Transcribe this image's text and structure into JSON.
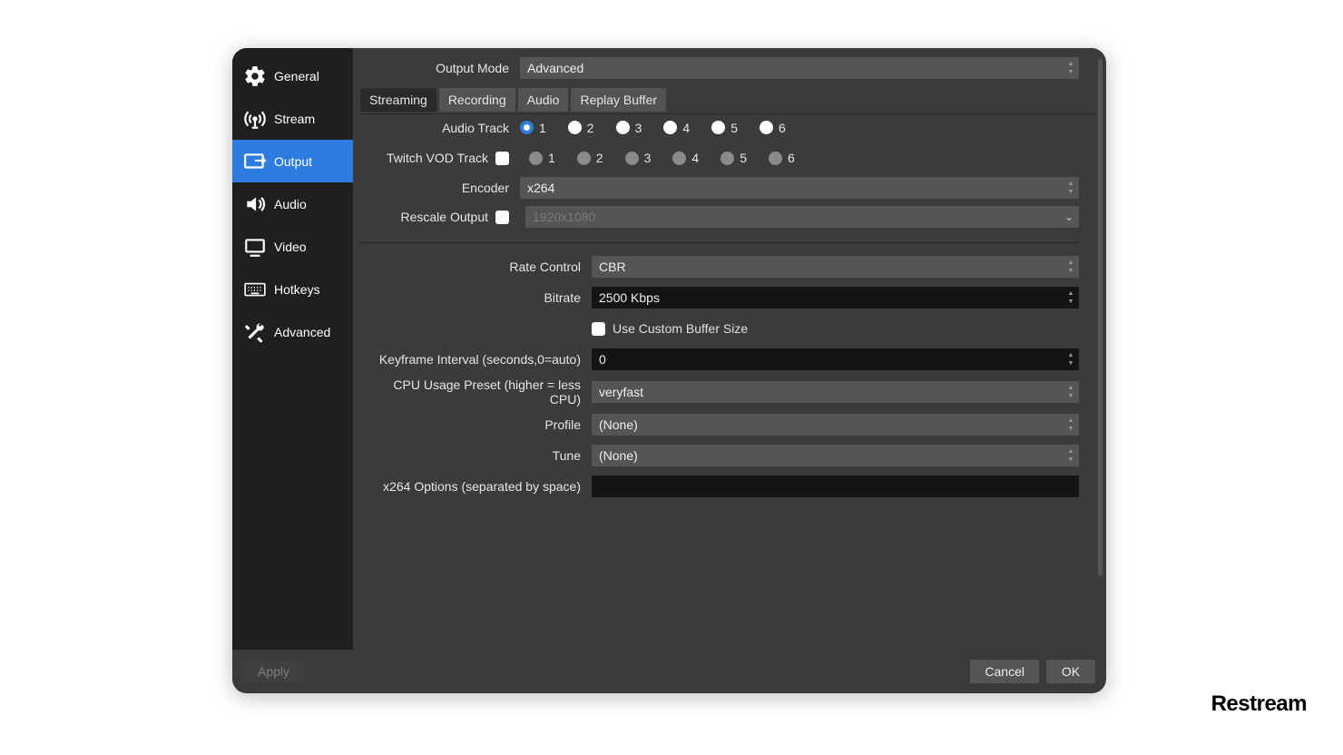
{
  "sidebar": {
    "items": [
      {
        "label": "General"
      },
      {
        "label": "Stream"
      },
      {
        "label": "Output"
      },
      {
        "label": "Audio"
      },
      {
        "label": "Video"
      },
      {
        "label": "Hotkeys"
      },
      {
        "label": "Advanced"
      }
    ],
    "active_index": 2
  },
  "header": {
    "output_mode_label": "Output Mode",
    "output_mode_value": "Advanced"
  },
  "tabs": {
    "items": [
      "Streaming",
      "Recording",
      "Audio",
      "Replay Buffer"
    ],
    "active_index": 0
  },
  "streaming": {
    "audio_track_label": "Audio Track",
    "audio_track_options": [
      "1",
      "2",
      "3",
      "4",
      "5",
      "6"
    ],
    "audio_track_selected": "1",
    "twitch_vod_label": "Twitch VOD Track",
    "twitch_vod_enabled": false,
    "twitch_vod_options": [
      "1",
      "2",
      "3",
      "4",
      "5",
      "6"
    ],
    "encoder_label": "Encoder",
    "encoder_value": "x264",
    "rescale_label": "Rescale Output",
    "rescale_enabled": false,
    "rescale_value": "1920x1080",
    "rate_control_label": "Rate Control",
    "rate_control_value": "CBR",
    "bitrate_label": "Bitrate",
    "bitrate_value": "2500 Kbps",
    "custom_buffer_label": "Use Custom Buffer Size",
    "custom_buffer_enabled": false,
    "keyframe_label": "Keyframe Interval (seconds,0=auto)",
    "keyframe_value": "0",
    "cpu_preset_label": "CPU Usage Preset (higher = less CPU)",
    "cpu_preset_value": "veryfast",
    "profile_label": "Profile",
    "profile_value": "(None)",
    "tune_label": "Tune",
    "tune_value": "(None)",
    "x264_opts_label": "x264 Options (separated by space)",
    "x264_opts_value": ""
  },
  "footer": {
    "apply": "Apply",
    "cancel": "Cancel",
    "ok": "OK"
  },
  "watermark": "Restream"
}
